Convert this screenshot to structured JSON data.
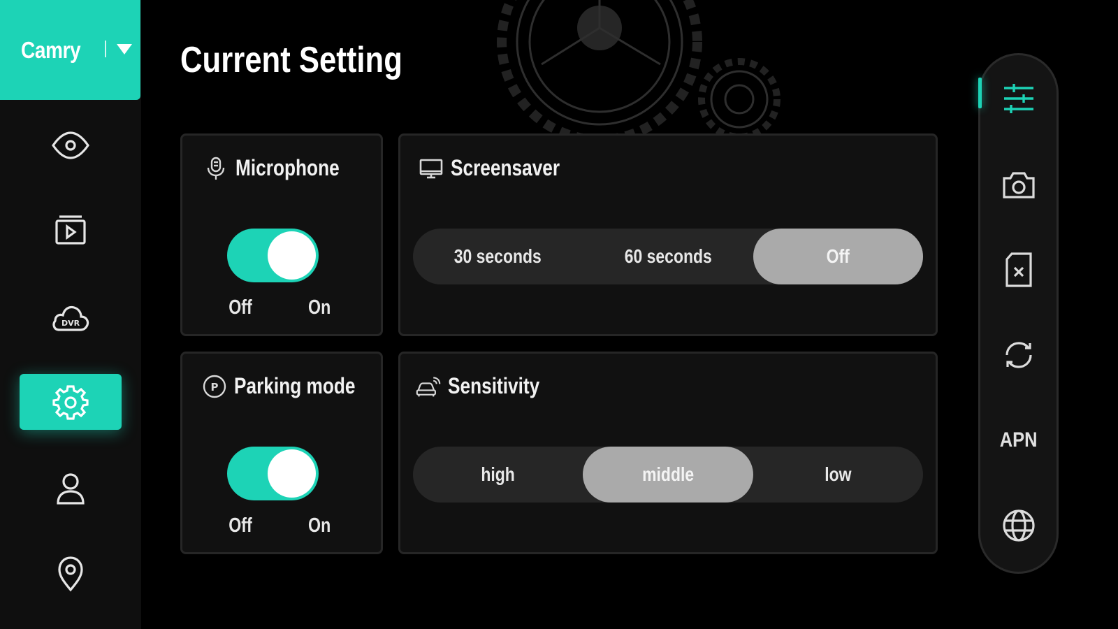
{
  "vehicle": {
    "name": "Camry"
  },
  "sidebar": {
    "items": [
      {
        "icon": "eye-icon",
        "active": false
      },
      {
        "icon": "video-playback-icon",
        "active": false
      },
      {
        "icon": "dvr-cloud-icon",
        "label": "DVR",
        "active": false
      },
      {
        "icon": "gear-icon",
        "active": true
      },
      {
        "icon": "user-icon",
        "active": false
      },
      {
        "icon": "location-pin-icon",
        "active": false
      }
    ]
  },
  "page": {
    "title": "Current Setting"
  },
  "microphone": {
    "title": "Microphone",
    "off_label": "Off",
    "on_label": "On",
    "state": "on"
  },
  "parking": {
    "title": "Parking mode",
    "off_label": "Off",
    "on_label": "On",
    "state": "on"
  },
  "screensaver": {
    "title": "Screensaver",
    "options": [
      "30 seconds",
      "60 seconds",
      "Off"
    ],
    "selected": "Off"
  },
  "sensitivity": {
    "title": "Sensitivity",
    "options": [
      "high",
      "middle",
      "low"
    ],
    "selected": "middle"
  },
  "rightbar": {
    "items": [
      {
        "icon": "sliders-icon",
        "active": true
      },
      {
        "icon": "camera-icon"
      },
      {
        "icon": "sd-card-format-icon"
      },
      {
        "icon": "refresh-icon"
      },
      {
        "icon": "apn-text",
        "label": "APN"
      },
      {
        "icon": "globe-icon"
      }
    ]
  },
  "colors": {
    "accent": "#1dd3b6",
    "background": "#000000",
    "card": "#111111",
    "selected_segment": "#aaaaaa"
  }
}
